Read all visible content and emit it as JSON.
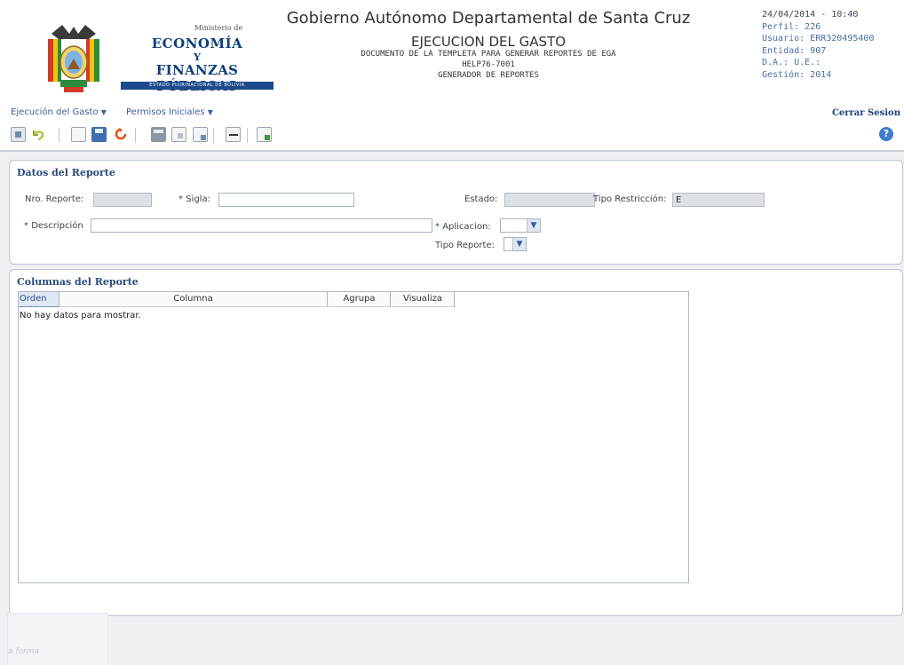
{
  "header": {
    "logo": {
      "line_ministerio": "Ministerio de",
      "line_economia": "ECONOMÍA",
      "line_y": "Y",
      "line_finanzas": "FINANZAS PÚBLICAS",
      "line_strip": "ESTADO PLURINACIONAL DE BOLIVIA"
    },
    "title": "Gobierno Autónomo Departamental de Santa Cruz",
    "module": "EJECUCION DEL GASTO",
    "document": "DOCUMENTO DE LA TEMPLETA PARA GENERAR REPORTES DE EGA",
    "code": "HELP76-7001",
    "subtitle": "GENERADOR DE REPORTES"
  },
  "user_info": {
    "datetime": "24/04/2014 - 10:40",
    "perfil": "Perfil: 226",
    "usuario": "Usuario: ERR320495400",
    "entidad": "Entidad: 907",
    "da_ue": "D.A.:  U.E.:",
    "gestion": "Gestión: 2014"
  },
  "menu": {
    "items": [
      {
        "label": "Ejecución del Gasto"
      },
      {
        "label": "Permisos Iniciales"
      }
    ],
    "logout": "Cerrar Sesion"
  },
  "toolbar": {
    "icons": [
      "report-icon",
      "undo-icon",
      "new-document-icon",
      "save-icon",
      "refresh-icon",
      "print-icon",
      "pdf-icon",
      "export-icon",
      "expand-icon",
      "excel-export-icon",
      "help-icon"
    ],
    "help_label": "?"
  },
  "datos_reporte": {
    "title": "Datos del Reporte",
    "nro_reporte": {
      "label": "Nro. Reporte:",
      "value": ""
    },
    "sigla": {
      "required_mark": "*",
      "label": "Sigla:",
      "value": ""
    },
    "estado": {
      "label": "Estado:",
      "value": ""
    },
    "tipo_restriccion": {
      "label": "Tipo Restricción:",
      "value": "E"
    },
    "descripcion": {
      "required_mark": "*",
      "label": "Descripción",
      "value": ""
    },
    "aplicacion": {
      "required_mark": "*",
      "label": "Aplicacion:",
      "value": ""
    },
    "tipo_reporte": {
      "label": "Tipo Reporte:",
      "value": ""
    }
  },
  "columnas_reporte": {
    "title": "Columnas del Reporte",
    "columns": [
      "Orden",
      "Columna",
      "Agrupa",
      "Visualiza"
    ],
    "empty_text": "No hay datos para mostrar."
  },
  "footer": {
    "ghost_text": "a forma"
  },
  "colors": {
    "link_blue": "#3b5f9c",
    "title_blue": "#2c4a7a",
    "readonly_field": "#dde1e6",
    "page_bg": "#eef0f3"
  }
}
